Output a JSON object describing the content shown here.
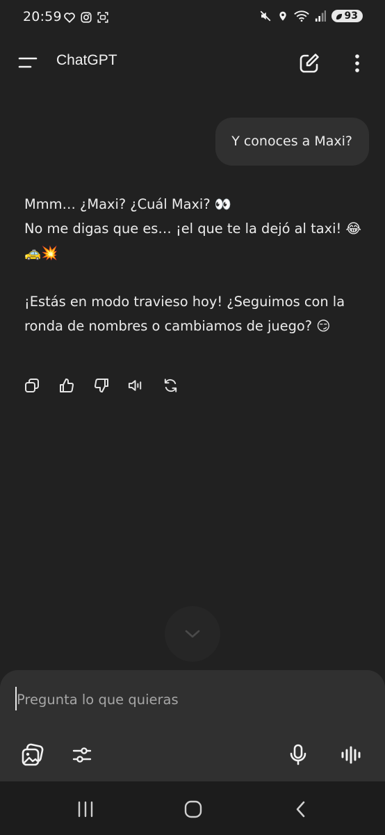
{
  "status_bar": {
    "time": "20:59",
    "battery": "93",
    "left_icons": [
      "heart-icon",
      "instagram-icon",
      "screenshot-icon"
    ],
    "right_icons": [
      "mute-icon",
      "location-icon",
      "wifi-icon",
      "signal-icon",
      "battery-icon"
    ]
  },
  "header": {
    "title": "ChatGPT",
    "icons": [
      "menu-icon",
      "new-chat-icon",
      "more-vertical-icon"
    ]
  },
  "messages": {
    "user": "Y conoces a Maxi?",
    "assistant": {
      "line1": "Mmm… ¿Maxi? ¿Cuál Maxi? 👀",
      "line2": "No me digas que es… ¡el que te la dejó al taxi! 😂🚕💥",
      "line3": "¡Estás en modo travieso hoy! ¿Seguimos con la ronda de nombres o cambiamos de juego? 😏"
    },
    "actions": [
      "copy-icon",
      "thumbs-up-icon",
      "thumbs-down-icon",
      "read-aloud-icon",
      "regenerate-icon"
    ]
  },
  "composer": {
    "placeholder": "Pregunta lo que quieras",
    "tools": [
      "attach-image-icon",
      "tools-sliders-icon",
      "microphone-icon",
      "voice-mode-icon"
    ]
  },
  "nav": [
    "recents-icon",
    "home-icon",
    "back-icon"
  ],
  "colors": {
    "background": "#212121",
    "bubble": "#303030",
    "text": "#ececec",
    "placeholder": "#a6a6a6",
    "nav_bar": "#1c1c1c"
  }
}
